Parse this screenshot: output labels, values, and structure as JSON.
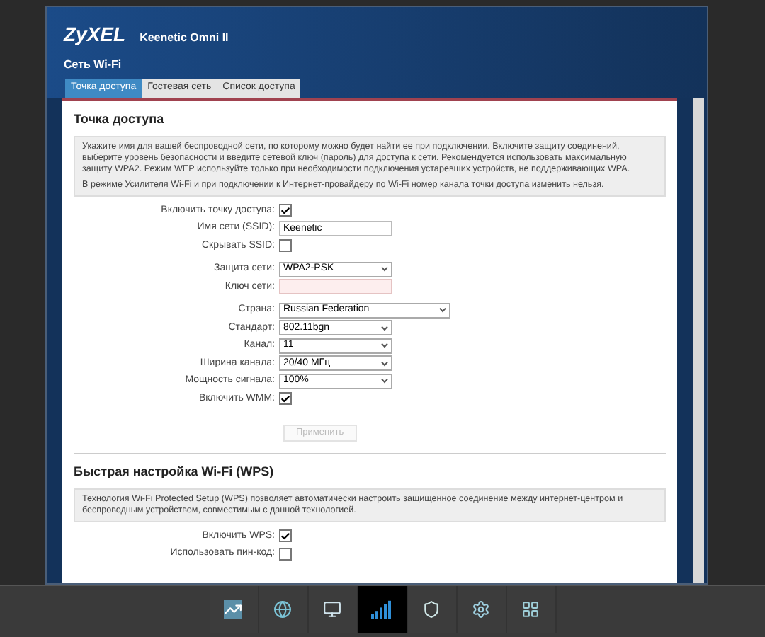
{
  "header": {
    "brand": "ZyXEL",
    "model": "Keenetic Omni II",
    "page_title": "Сеть Wi-Fi"
  },
  "tabs": [
    {
      "label": "Точка доступа",
      "selected": true
    },
    {
      "label": "Гостевая сеть",
      "selected": false
    },
    {
      "label": "Список доступа",
      "selected": false
    }
  ],
  "sections": [
    {
      "title": "Точка доступа",
      "info": [
        "Укажите имя для вашей беспроводной сети, по которому можно будет найти ее при подключении. Включите защиту соединений, выберите уровень безопасности и введите сетевой ключ (пароль) для доступа к сети. Рекомендуется использовать максимальную защиту WPA2. Режим WEP используйте только при необходимости подключения устаревших устройств, не поддерживающих WPA.",
        "В режиме Усилителя Wi-Fi и при подключении к Интернет-провайдеру по Wi-Fi номер канала точки доступа изменить нельзя."
      ],
      "groups": [
        [
          {
            "kind": "checkbox",
            "label": "Включить точку доступа:",
            "checked": true
          },
          {
            "kind": "text",
            "label": "Имя сети (SSID):",
            "value": "Keenetic",
            "invalid": false
          },
          {
            "kind": "checkbox",
            "label": "Скрывать SSID:",
            "checked": false
          }
        ],
        [
          {
            "kind": "select",
            "label": "Защита сети:",
            "value": "WPA2-PSK",
            "wide": false
          },
          {
            "kind": "text",
            "label": "Ключ сети:",
            "invalid": true
          }
        ],
        [
          {
            "kind": "select",
            "label": "Страна:",
            "value": "Russian Federation",
            "wide": true
          },
          {
            "kind": "select",
            "label": "Стандарт:",
            "value": "802.11bgn",
            "wide": false
          },
          {
            "kind": "select",
            "label": "Канал:",
            "value": "11",
            "wide": false
          },
          {
            "kind": "select",
            "label": "Ширина канала:",
            "value": "20/40 МГц",
            "wide": false
          },
          {
            "kind": "select",
            "label": "Мощность сигнала:",
            "value": "100%",
            "wide": false
          },
          {
            "kind": "checkbox",
            "label": "Включить WMM:",
            "checked": true
          }
        ]
      ],
      "apply": {
        "label": "Применить",
        "disabled": true
      }
    },
    {
      "title": "Быстрая настройка Wi-Fi (WPS)",
      "info": [
        "Технология Wi-Fi Protected Setup (WPS) позволяет автоматически настроить защищенное соединение между интернет-центром и беспроводным устройством, совместимым с данной технологией."
      ],
      "groups": [
        [
          {
            "kind": "checkbox",
            "label": "Включить WPS:",
            "checked": true
          },
          {
            "kind": "checkbox",
            "label": "Использовать пин-код:",
            "checked": false
          }
        ]
      ]
    }
  ],
  "taskbar": [
    {
      "kind": "chart",
      "selected": false
    },
    {
      "kind": "globe",
      "selected": false
    },
    {
      "kind": "network",
      "selected": false
    },
    {
      "kind": "signal",
      "selected": true
    },
    {
      "kind": "shield",
      "selected": false
    },
    {
      "kind": "gear",
      "selected": false
    },
    {
      "kind": "grid",
      "selected": false
    }
  ]
}
